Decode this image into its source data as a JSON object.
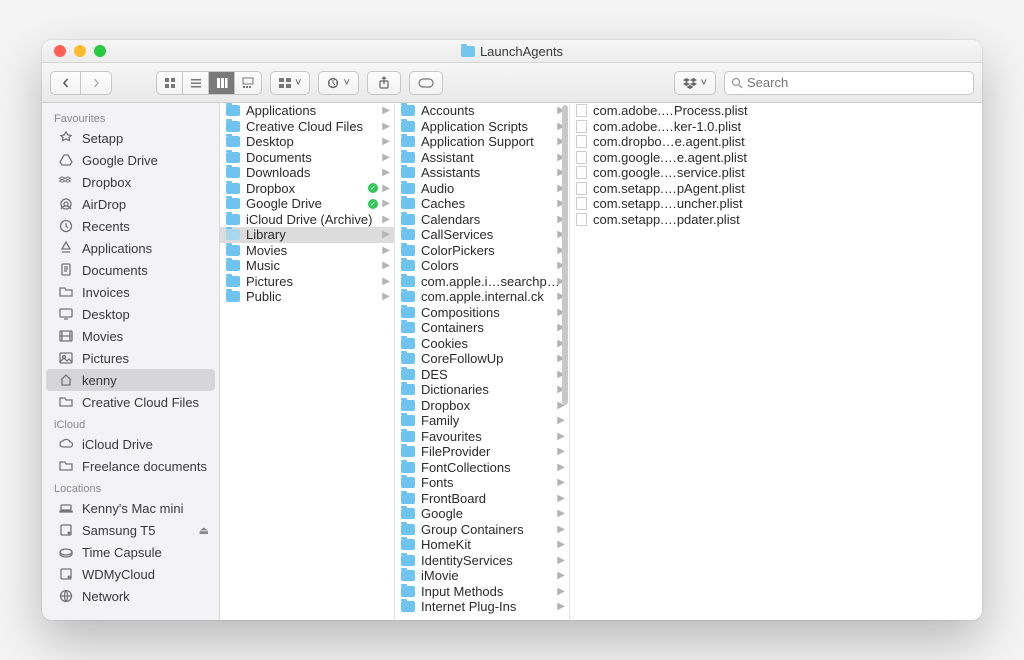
{
  "window": {
    "title": "LaunchAgents"
  },
  "search": {
    "placeholder": "Search"
  },
  "sidebar": {
    "sections": [
      {
        "title": "Favourites",
        "items": [
          {
            "icon": "setapp",
            "label": "Setapp"
          },
          {
            "icon": "gdrive",
            "label": "Google Drive"
          },
          {
            "icon": "dropbox",
            "label": "Dropbox"
          },
          {
            "icon": "airdrop",
            "label": "AirDrop"
          },
          {
            "icon": "recents",
            "label": "Recents"
          },
          {
            "icon": "apps",
            "label": "Applications"
          },
          {
            "icon": "docs",
            "label": "Documents"
          },
          {
            "icon": "folder",
            "label": "Invoices"
          },
          {
            "icon": "desktop",
            "label": "Desktop"
          },
          {
            "icon": "movies",
            "label": "Movies"
          },
          {
            "icon": "pictures",
            "label": "Pictures"
          },
          {
            "icon": "home",
            "label": "kenny",
            "selected": true
          },
          {
            "icon": "folder",
            "label": "Creative Cloud Files"
          }
        ]
      },
      {
        "title": "iCloud",
        "items": [
          {
            "icon": "cloud",
            "label": "iCloud Drive"
          },
          {
            "icon": "folder",
            "label": "Freelance documents"
          }
        ]
      },
      {
        "title": "Locations",
        "items": [
          {
            "icon": "mac",
            "label": "Kenny's Mac mini"
          },
          {
            "icon": "disk",
            "label": "Samsung T5",
            "eject": true
          },
          {
            "icon": "time",
            "label": "Time Capsule"
          },
          {
            "icon": "disk",
            "label": "WDMyCloud"
          },
          {
            "icon": "globe",
            "label": "Network"
          }
        ]
      }
    ]
  },
  "columns": [
    {
      "items": [
        {
          "label": "Applications",
          "arrow": true
        },
        {
          "label": "Creative Cloud Files",
          "arrow": true
        },
        {
          "label": "Desktop",
          "arrow": true
        },
        {
          "label": "Documents",
          "arrow": true
        },
        {
          "label": "Downloads",
          "arrow": true
        },
        {
          "label": "Dropbox",
          "arrow": true,
          "sync": true
        },
        {
          "label": "Google Drive",
          "arrow": true,
          "sync": true
        },
        {
          "label": "iCloud Drive (Archive)",
          "arrow": true
        },
        {
          "label": "Library",
          "arrow": true,
          "selected": true
        },
        {
          "label": "Movies",
          "arrow": true
        },
        {
          "label": "Music",
          "arrow": true
        },
        {
          "label": "Pictures",
          "arrow": true
        },
        {
          "label": "Public",
          "arrow": true
        }
      ]
    },
    {
      "items": [
        {
          "label": "Accounts",
          "arrow": true
        },
        {
          "label": "Application Scripts",
          "arrow": true
        },
        {
          "label": "Application Support",
          "arrow": true
        },
        {
          "label": "Assistant",
          "arrow": true
        },
        {
          "label": "Assistants",
          "arrow": true
        },
        {
          "label": "Audio",
          "arrow": true
        },
        {
          "label": "Caches",
          "arrow": true
        },
        {
          "label": "Calendars",
          "arrow": true
        },
        {
          "label": "CallServices",
          "arrow": true
        },
        {
          "label": "ColorPickers",
          "arrow": true
        },
        {
          "label": "Colors",
          "arrow": true
        },
        {
          "label": "com.apple.i…searchpartyd",
          "arrow": true
        },
        {
          "label": "com.apple.internal.ck",
          "arrow": true
        },
        {
          "label": "Compositions",
          "arrow": true
        },
        {
          "label": "Containers",
          "arrow": true
        },
        {
          "label": "Cookies",
          "arrow": true
        },
        {
          "label": "CoreFollowUp",
          "arrow": true
        },
        {
          "label": "DES",
          "arrow": true
        },
        {
          "label": "Dictionaries",
          "arrow": true
        },
        {
          "label": "Dropbox",
          "arrow": true
        },
        {
          "label": "Family",
          "arrow": true
        },
        {
          "label": "Favourites",
          "arrow": true
        },
        {
          "label": "FileProvider",
          "arrow": true
        },
        {
          "label": "FontCollections",
          "arrow": true
        },
        {
          "label": "Fonts",
          "arrow": true
        },
        {
          "label": "FrontBoard",
          "arrow": true
        },
        {
          "label": "Google",
          "arrow": true
        },
        {
          "label": "Group Containers",
          "arrow": true
        },
        {
          "label": "HomeKit",
          "arrow": true
        },
        {
          "label": "IdentityServices",
          "arrow": true
        },
        {
          "label": "iMovie",
          "arrow": true
        },
        {
          "label": "Input Methods",
          "arrow": true
        },
        {
          "label": "Internet Plug-Ins",
          "arrow": true
        }
      ]
    },
    {
      "items": [
        {
          "label": "com.adobe.…Process.plist",
          "file": true
        },
        {
          "label": "com.adobe.…ker-1.0.plist",
          "file": true
        },
        {
          "label": "com.dropbo…e.agent.plist",
          "file": true
        },
        {
          "label": "com.google.…e.agent.plist",
          "file": true
        },
        {
          "label": "com.google.…service.plist",
          "file": true
        },
        {
          "label": "com.setapp.…pAgent.plist",
          "file": true
        },
        {
          "label": "com.setapp.…uncher.plist",
          "file": true
        },
        {
          "label": "com.setapp.…pdater.plist",
          "file": true
        }
      ]
    }
  ]
}
